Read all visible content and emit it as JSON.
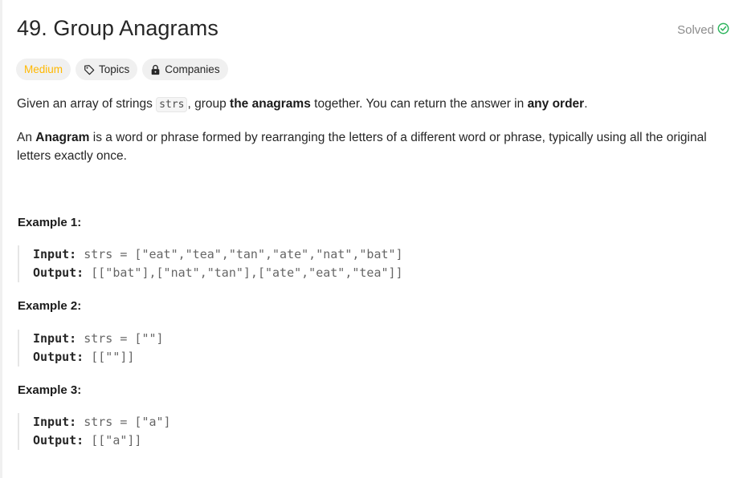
{
  "problem": {
    "title": "49. Group Anagrams",
    "status": "Solved",
    "colors": {
      "medium": "#ffb800",
      "solved": "#2db55d"
    }
  },
  "tags": {
    "difficulty": "Medium",
    "topics": "Topics",
    "companies": "Companies"
  },
  "description": {
    "p1_a": "Given an array of strings ",
    "p1_code": "strs",
    "p1_b": ", group ",
    "p1_strong1": "the anagrams",
    "p1_c": " together. You can return the answer in ",
    "p1_strong2": "any order",
    "p1_d": ".",
    "p2_a": "An ",
    "p2_strong": "Anagram",
    "p2_b": " is a word or phrase formed by rearranging the letters of a different word or phrase, typically using all the original letters exactly once."
  },
  "examples": [
    {
      "title": "Example 1:",
      "input_label": "Input:",
      "input_value": " strs = [\"eat\",\"tea\",\"tan\",\"ate\",\"nat\",\"bat\"]",
      "output_label": "Output:",
      "output_value": " [[\"bat\"],[\"nat\",\"tan\"],[\"ate\",\"eat\",\"tea\"]]"
    },
    {
      "title": "Example 2:",
      "input_label": "Input:",
      "input_value": " strs = [\"\"]",
      "output_label": "Output:",
      "output_value": " [[\"\"]]"
    },
    {
      "title": "Example 3:",
      "input_label": "Input:",
      "input_value": " strs = [\"a\"]",
      "output_label": "Output:",
      "output_value": " [[\"a\"]]"
    }
  ]
}
